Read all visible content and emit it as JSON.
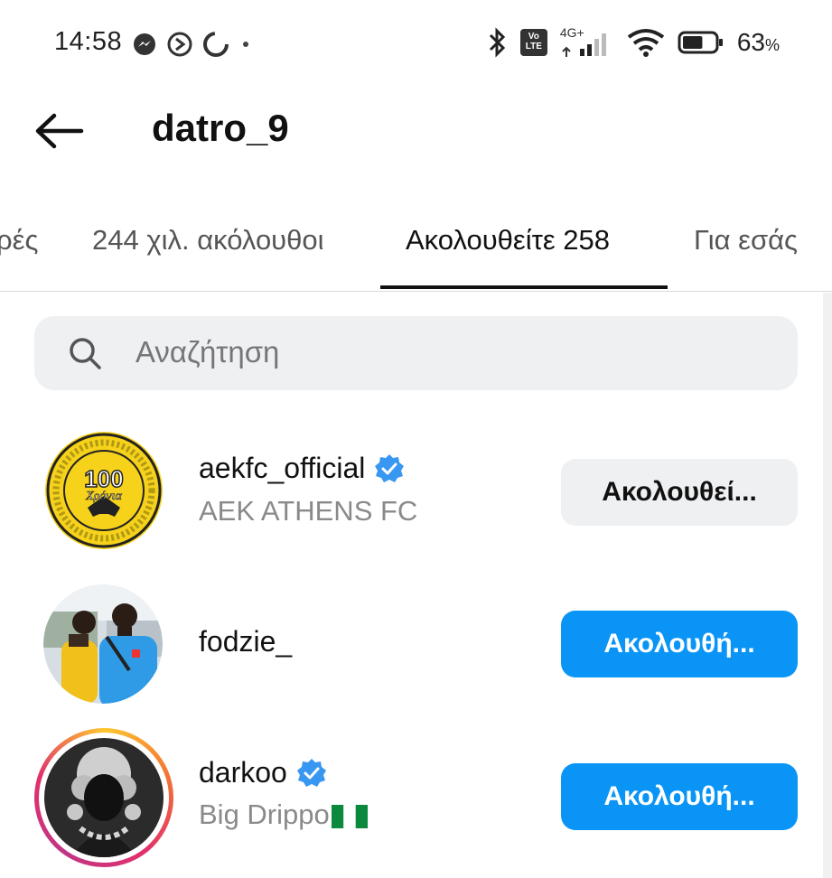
{
  "status_bar": {
    "time": "14:58",
    "network": "4G+",
    "volte": "Vo\nLTE",
    "battery_text": "63",
    "battery_unit": "%",
    "battery_level": 0.63
  },
  "header": {
    "title": "datro_9"
  },
  "tabs": [
    {
      "label": "ρές"
    },
    {
      "label": "244 χιλ. ακόλουθοι"
    },
    {
      "label": "Ακολουθείτε 258"
    },
    {
      "label": "Για εσάς"
    }
  ],
  "search": {
    "placeholder": "Αναζήτηση"
  },
  "users": [
    {
      "username": "aekfc_official",
      "verified": true,
      "subtitle": "AEK ATHENS FC",
      "button": "Ακολουθεί..."
    },
    {
      "username": "fodzie_",
      "verified": false,
      "subtitle": "",
      "button": "Ακολουθή..."
    },
    {
      "username": "darkoo",
      "verified": true,
      "subtitle": "Big Drippo",
      "button": "Ακολουθή..."
    }
  ],
  "avatar1": {
    "logo_text": "100",
    "logo_sub": "Χρόνια"
  },
  "colors": {
    "accent_blue": "#0a95f6",
    "verified_blue": "#3897f0",
    "aek_yellow": "#f6d21b"
  }
}
